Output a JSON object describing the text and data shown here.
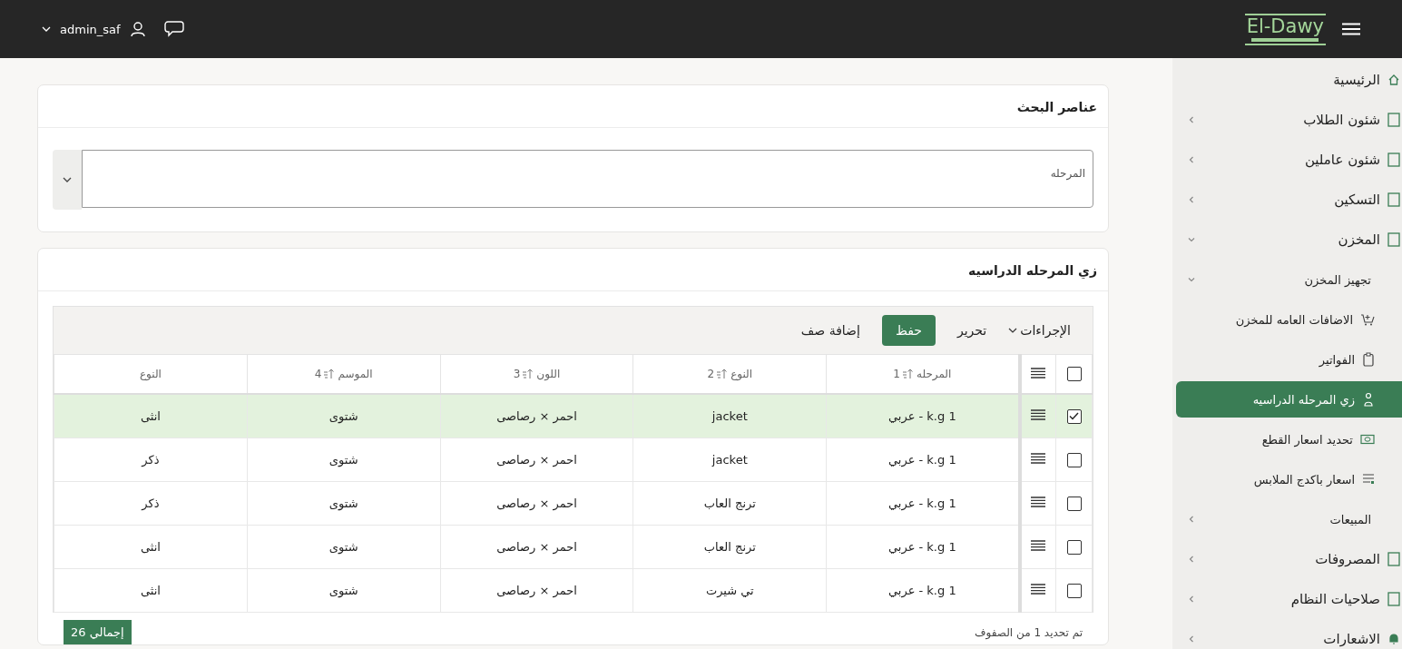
{
  "header": {
    "user": "admin_saf",
    "logo": "El-Dawy"
  },
  "sidebar": {
    "items": [
      {
        "label": "الرئيسية",
        "selected": false
      },
      {
        "label": "شئون الطلاب",
        "selected": false,
        "expanded": false
      },
      {
        "label": "شئون عاملين",
        "selected": false,
        "expanded": false
      },
      {
        "label": "التسكين",
        "selected": false,
        "expanded": false
      },
      {
        "label": "المخزن",
        "selected": false,
        "expanded": true,
        "children": [
          {
            "label": "تجهيز المخزن",
            "selected": false,
            "expanded": true,
            "children": [
              {
                "label": "الاضافات العامه للمخزن",
                "selected": false
              },
              {
                "label": "الفواتير",
                "selected": false
              },
              {
                "label": "زي المرحله الدراسيه",
                "selected": true
              },
              {
                "label": "تحديد اسعار القطع",
                "selected": false
              },
              {
                "label": "اسعار باكدج الملابس",
                "selected": false
              }
            ]
          },
          {
            "label": "المبيعات",
            "selected": false,
            "expanded": false
          }
        ]
      },
      {
        "label": "المصروفات",
        "selected": false,
        "expanded": false
      },
      {
        "label": "صلاحيات النظام",
        "selected": false,
        "expanded": false
      },
      {
        "label": "الاشعارات",
        "selected": false,
        "expanded": false
      }
    ]
  },
  "search": {
    "title": "عناصر البحث",
    "field": {
      "placeholder": "المرحله"
    }
  },
  "grid": {
    "title": "زي المرحله الدراسيه",
    "toolbar": {
      "actions": "الإجراءات",
      "edit": "تحرير",
      "save": "حفظ",
      "add_row": "إضافة صف"
    },
    "all_checked": false,
    "columns": [
      {
        "label": "المرحله",
        "sort": "1"
      },
      {
        "label": "النوع",
        "sort": "2"
      },
      {
        "label": "اللون",
        "sort": "3"
      },
      {
        "label": "الموسم",
        "sort": "4"
      },
      {
        "label": "النوع"
      }
    ],
    "rows": [
      {
        "checked": true,
        "cells": [
          "1 k.g - عربي",
          "jacket",
          "احمر × رصاصى",
          "شتوى",
          "انثى"
        ]
      },
      {
        "checked": false,
        "cells": [
          "1 k.g - عربي",
          "jacket",
          "احمر × رصاصى",
          "شتوى",
          "ذكر"
        ]
      },
      {
        "checked": false,
        "cells": [
          "1 k.g - عربي",
          "ترنج العاب",
          "احمر × رصاصى",
          "شتوى",
          "ذكر"
        ]
      },
      {
        "checked": false,
        "cells": [
          "1 k.g - عربي",
          "ترنج العاب",
          "احمر × رصاصى",
          "شتوى",
          "انثى"
        ]
      },
      {
        "checked": false,
        "cells": [
          "1 k.g - عربي",
          "تي شيرت",
          "احمر × رصاصى",
          "شتوى",
          "انثى"
        ]
      }
    ],
    "selection_note": "تم تحديد 1 من الصفوف",
    "total": "إجمالي 26"
  }
}
